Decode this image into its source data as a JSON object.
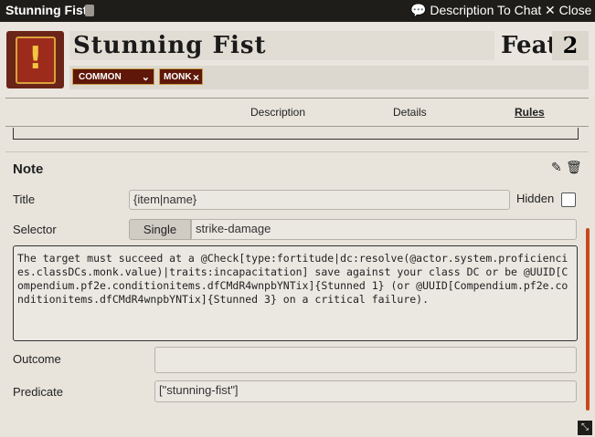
{
  "window": {
    "title": "Stunning Fist",
    "header_actions": {
      "description_to_chat": "Description To Chat",
      "close": "Close"
    }
  },
  "item": {
    "name": "Stunning Fist",
    "type": "Feat",
    "level": "2",
    "rarity": "COMMON",
    "traits": [
      "MONK"
    ]
  },
  "tabs": [
    {
      "label": "Description",
      "active": false
    },
    {
      "label": "Details",
      "active": false
    },
    {
      "label": "Rules",
      "active": true
    }
  ],
  "rule": {
    "heading": "Note",
    "title_label": "Title",
    "title_value": "{item|name}",
    "hidden_label": "Hidden",
    "hidden_checked": false,
    "selector_label": "Selector",
    "selector_mode": "Single",
    "selector_value": "strike-damage",
    "text": "The target must succeed at a @Check[type:fortitude|dc:resolve(@actor.system.proficiencies.classDCs.monk.value)|traits:incapacitation] save against your class DC or be @UUID[Compendium.pf2e.conditionitems.dfCMdR4wnpbYNTix]{Stunned 1} (or @UUID[Compendium.pf2e.conditionitems.dfCMdR4wnpbYNTix]{Stunned 3} on a critical failure).",
    "outcome_label": "Outcome",
    "outcome_value": "",
    "predicate_label": "Predicate",
    "predicate_value": "[\"stunning-fist\"]"
  },
  "colors": {
    "accent": "#c84a1a",
    "trait_bg": "#5e1708",
    "titlebar": "#1f1d1a"
  }
}
